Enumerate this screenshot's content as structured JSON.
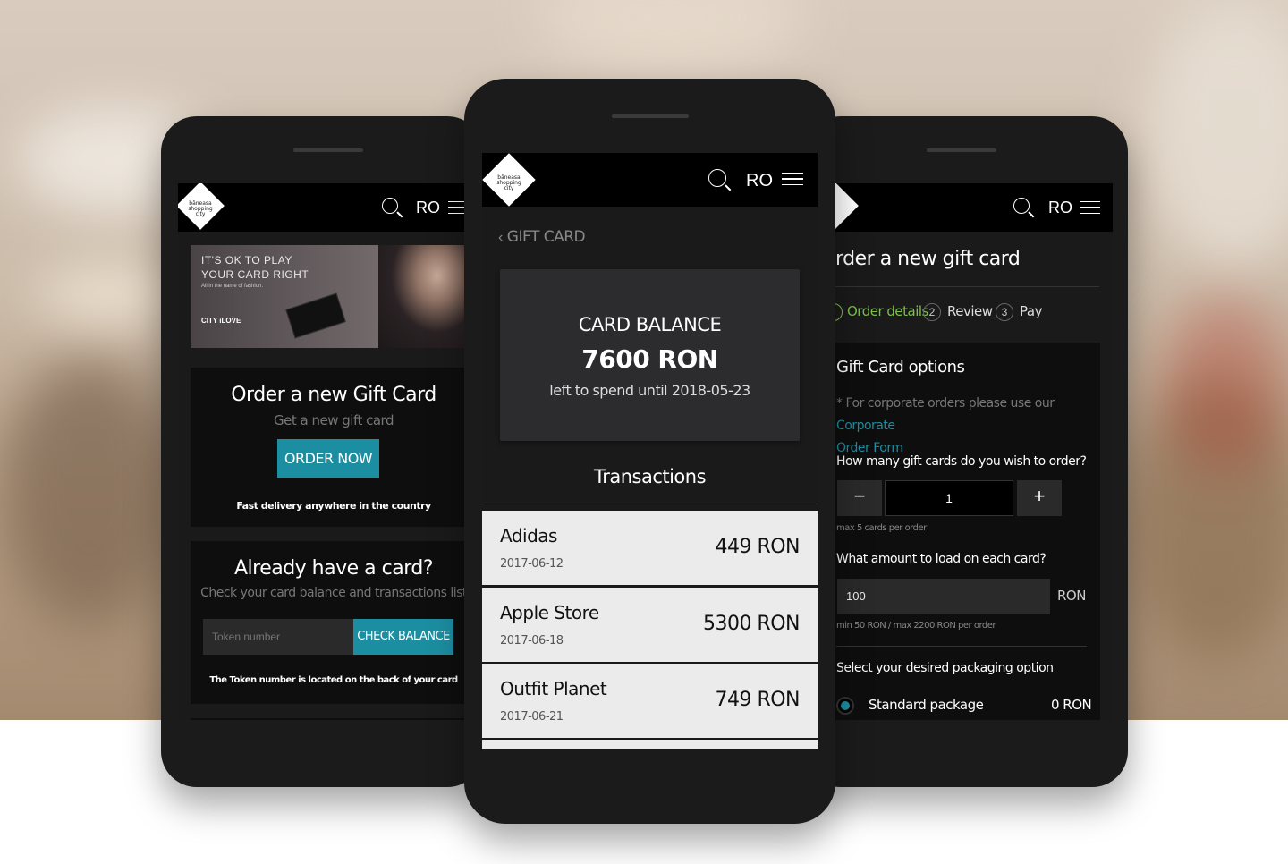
{
  "header": {
    "lang": "RO",
    "logo_text": [
      "băneasa",
      "shopping",
      "city"
    ]
  },
  "left": {
    "banner": {
      "line1": "IT'S OK TO PLAY",
      "line2": "YOUR CARD RIGHT",
      "line3": "All in the name of fashion.",
      "brand": "CITY iLOVE"
    },
    "order": {
      "title": "Order a new Gift Card",
      "subtitle": "Get a new gift card",
      "button": "ORDER NOW",
      "note": "Fast delivery anywhere in the country"
    },
    "check": {
      "title": "Already have a card?",
      "subtitle": "Check your card balance and transactions list",
      "placeholder": "Token number",
      "button": "CHECK BALANCE",
      "note": "The Token number is located on the back of your card"
    }
  },
  "center": {
    "back_label": "GIFT CARD",
    "balance": {
      "label": "CARD BALANCE",
      "amount": "7600 RON",
      "until": "left to spend until 2018-05-23"
    },
    "transactions_title": "Transactions",
    "transactions": [
      {
        "merchant": "Adidas",
        "date": "2017-06-12",
        "amount": "449 RON"
      },
      {
        "merchant": "Apple Store",
        "date": "2017-06-18",
        "amount": "5300 RON"
      },
      {
        "merchant": "Outfit Planet",
        "date": "2017-06-21",
        "amount": "749 RON"
      }
    ]
  },
  "right": {
    "title": "rder a new gift card",
    "steps": [
      {
        "num": "",
        "label": "Order details"
      },
      {
        "num": "2",
        "label": "Review"
      },
      {
        "num": "3",
        "label": "Pay"
      }
    ],
    "options_title": "Gift Card options",
    "corporate_prefix": "* For corporate orders please use our",
    "corporate_link1": "Corporate",
    "corporate_link2": "Order Form",
    "qty_question": "How many gift cards do you wish to order?",
    "qty_minus": "−",
    "qty_value": "1",
    "qty_plus": "+",
    "qty_note": "max 5 cards per order",
    "amount_question": "What amount to load on each card?",
    "amount_value": "100",
    "amount_unit": "RON",
    "amount_note": "min 50 RON / max 2200 RON per order",
    "pack_question": "Select your desired packaging option",
    "pack_option": "Standard package",
    "pack_price": "0 RON"
  },
  "colors": {
    "accent": "#1c8ea1",
    "green": "#7cc04a",
    "link": "#1c8ea1"
  }
}
